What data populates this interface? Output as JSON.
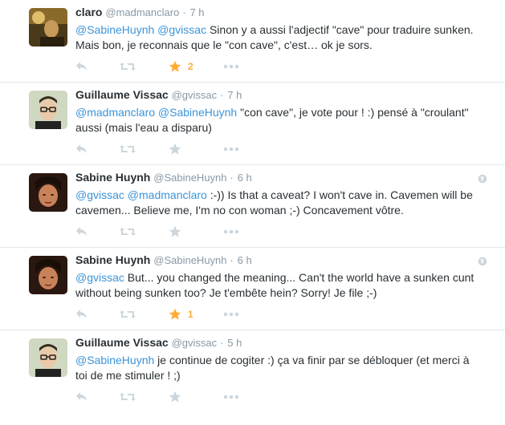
{
  "tweets": [
    {
      "fullname": "claro",
      "username": "@madmanclaro",
      "dot": "·",
      "time": "7 h",
      "show_globe": false,
      "line1": [
        {
          "text": "@SabineHuynh",
          "mention": true
        },
        {
          "text": " ",
          "mention": false
        },
        {
          "text": "@gvissac",
          "mention": true
        },
        {
          "text": " Sinon y a aussi l'adjectif \"cave\" pour traduire sunken.",
          "mention": false
        }
      ],
      "line2": [
        {
          "text": "Mais bon, je reconnais que le \"con cave\", c'est… ok je sors.",
          "mention": false
        }
      ],
      "favorite_count": "2",
      "favorited": true
    },
    {
      "fullname": "Guillaume Vissac",
      "username": "@gvissac",
      "dot": "·",
      "time": "7 h",
      "show_globe": false,
      "line1": [
        {
          "text": "@madmanclaro",
          "mention": true
        },
        {
          "text": " ",
          "mention": false
        },
        {
          "text": "@SabineHuynh",
          "mention": true
        },
        {
          "text": " \"con cave\", je vote pour ! :) pensé à \"croulant\"",
          "mention": false
        }
      ],
      "line2": [
        {
          "text": "aussi (mais l'eau a disparu)",
          "mention": false
        }
      ],
      "favorite_count": "",
      "favorited": false
    },
    {
      "fullname": "Sabine Huynh",
      "username": "@SabineHuynh",
      "dot": "·",
      "time": "6 h",
      "show_globe": true,
      "line1": [
        {
          "text": "@gvissac",
          "mention": true
        },
        {
          "text": " ",
          "mention": false
        },
        {
          "text": "@madmanclaro",
          "mention": true
        },
        {
          "text": " :-)) Is that a caveat? I won't cave in. Cavemen will be",
          "mention": false
        }
      ],
      "line2": [
        {
          "text": "cavemen... Believe me, I'm no con woman ;-) Concavement vôtre.",
          "mention": false
        }
      ],
      "favorite_count": "",
      "favorited": false
    },
    {
      "fullname": "Sabine Huynh",
      "username": "@SabineHuynh",
      "dot": "·",
      "time": "6 h",
      "show_globe": true,
      "line1": [
        {
          "text": "@gvissac",
          "mention": true
        },
        {
          "text": " But... you changed the meaning... Can't the world have a sunken cunt",
          "mention": false
        }
      ],
      "line2": [
        {
          "text": "without being sunken too? Je t'embête hein? Sorry! Je file ;-)",
          "mention": false
        }
      ],
      "favorite_count": "1",
      "favorited": true
    },
    {
      "fullname": "Guillaume Vissac",
      "username": "@gvissac",
      "dot": "·",
      "time": "5 h",
      "show_globe": false,
      "line1": [
        {
          "text": "@SabineHuynh",
          "mention": true
        },
        {
          "text": " je continue de cogiter :) ça va finir par se débloquer (et merci à",
          "mention": false
        }
      ],
      "line2": [
        {
          "text": "toi de me stimuler ! ;)",
          "mention": false
        }
      ],
      "favorite_count": "",
      "favorited": false
    }
  ],
  "avatars": [
    "claro",
    "guillaume",
    "sabine",
    "sabine",
    "guillaume"
  ],
  "icons": {
    "reply": "reply-icon",
    "retweet": "retweet-icon",
    "favorite": "star-icon",
    "more": "more-icon",
    "globe": "globe-icon"
  },
  "colors": {
    "mention": "#3b94d9",
    "meta": "#8899a6",
    "action_gray": "#ccd6dd",
    "favorite_active": "#ffac33",
    "divider": "#e1e8ed"
  }
}
